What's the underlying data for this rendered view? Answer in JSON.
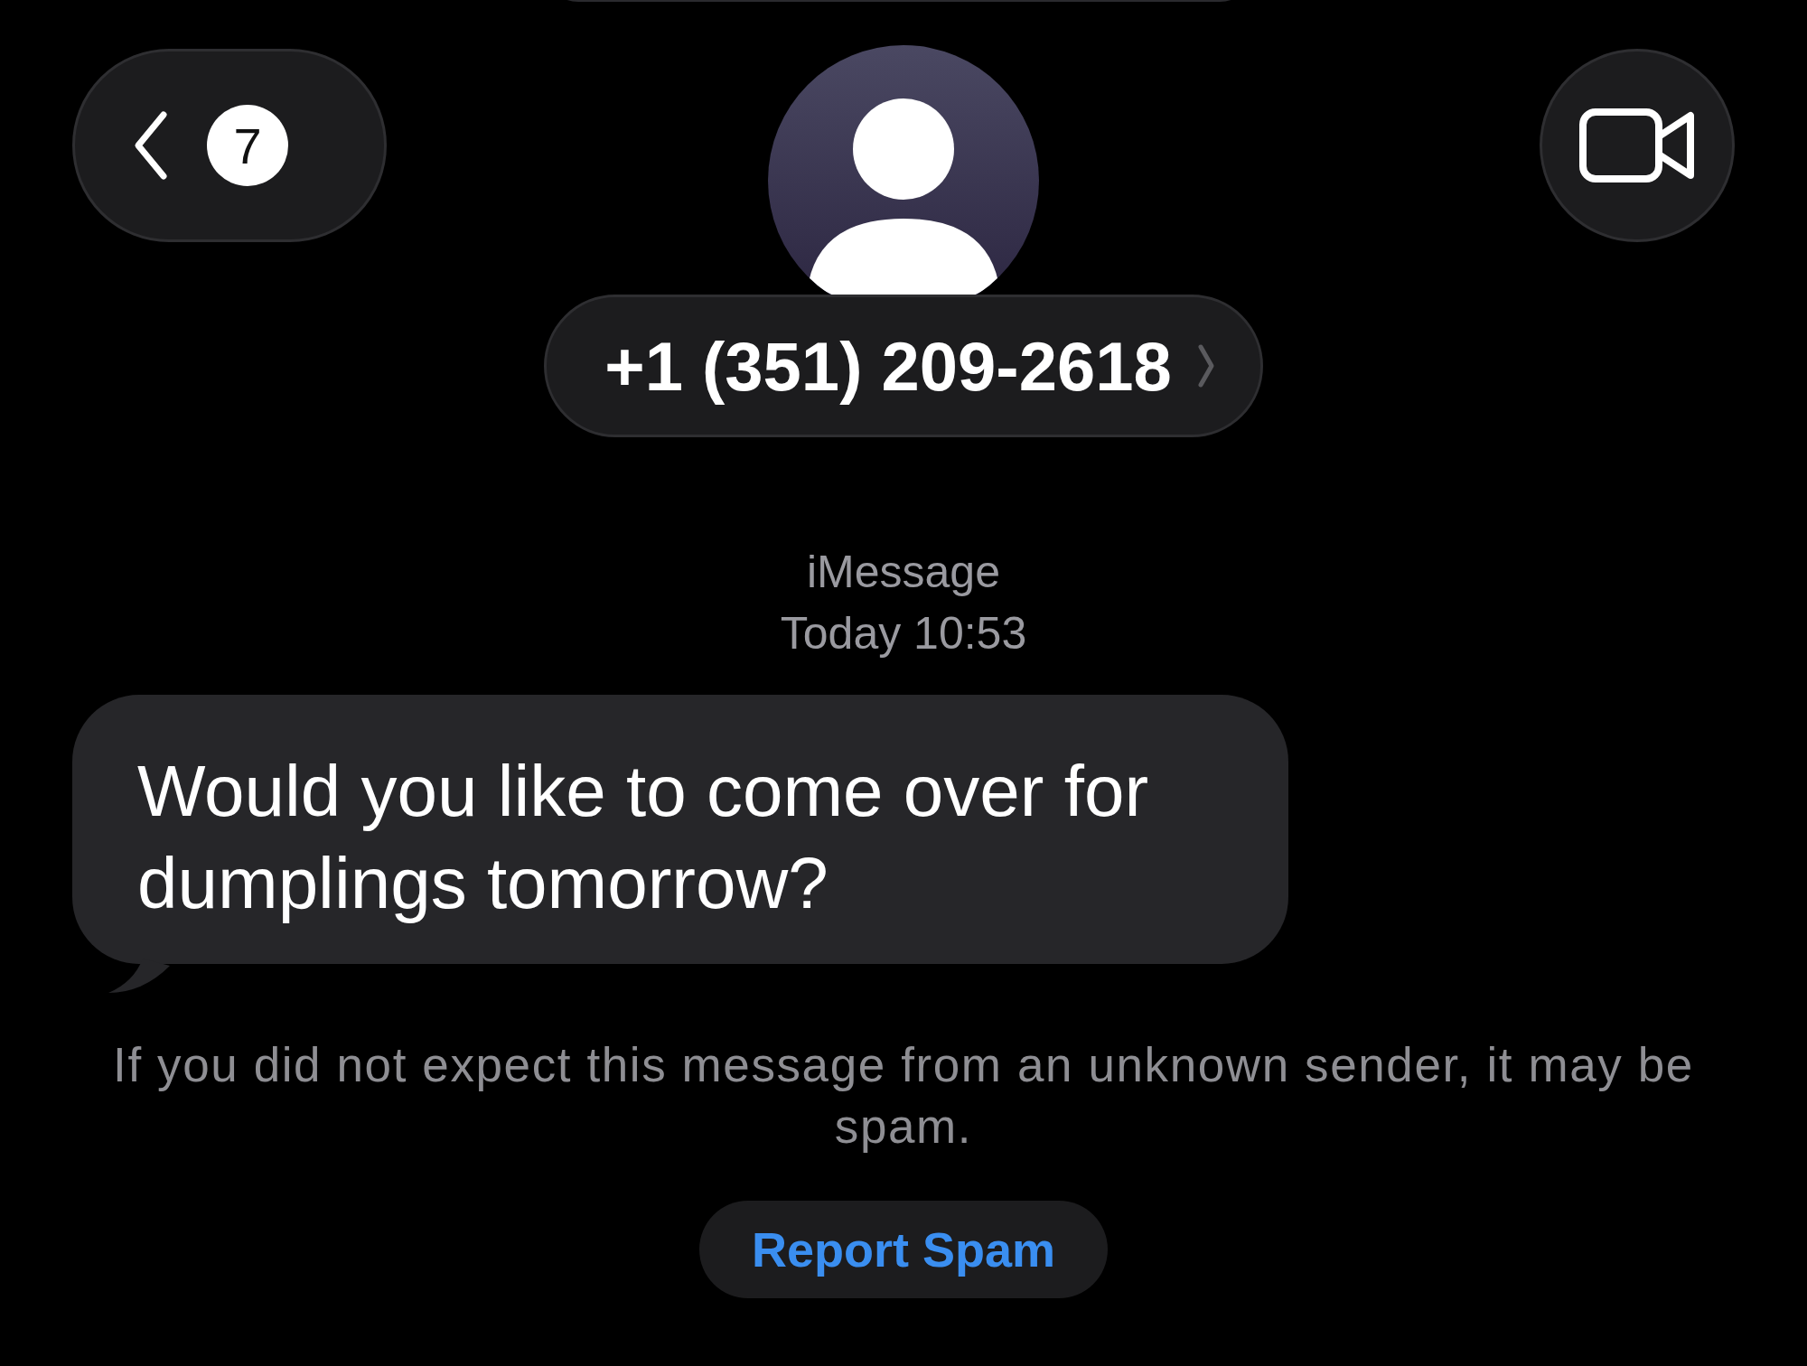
{
  "header": {
    "back_button": {
      "badge": "7"
    },
    "contact": {
      "number": "+1 (351) 209-2618"
    }
  },
  "service": "iMessage",
  "timestamp": "Today 10:53",
  "messages": [
    {
      "kind": "incoming",
      "text": "Would you like to come over for dumplings tomorrow?"
    }
  ],
  "spam_notice": "If you did not expect this message from an unknown sender, it may be spam.",
  "report_button": "Report Spam"
}
